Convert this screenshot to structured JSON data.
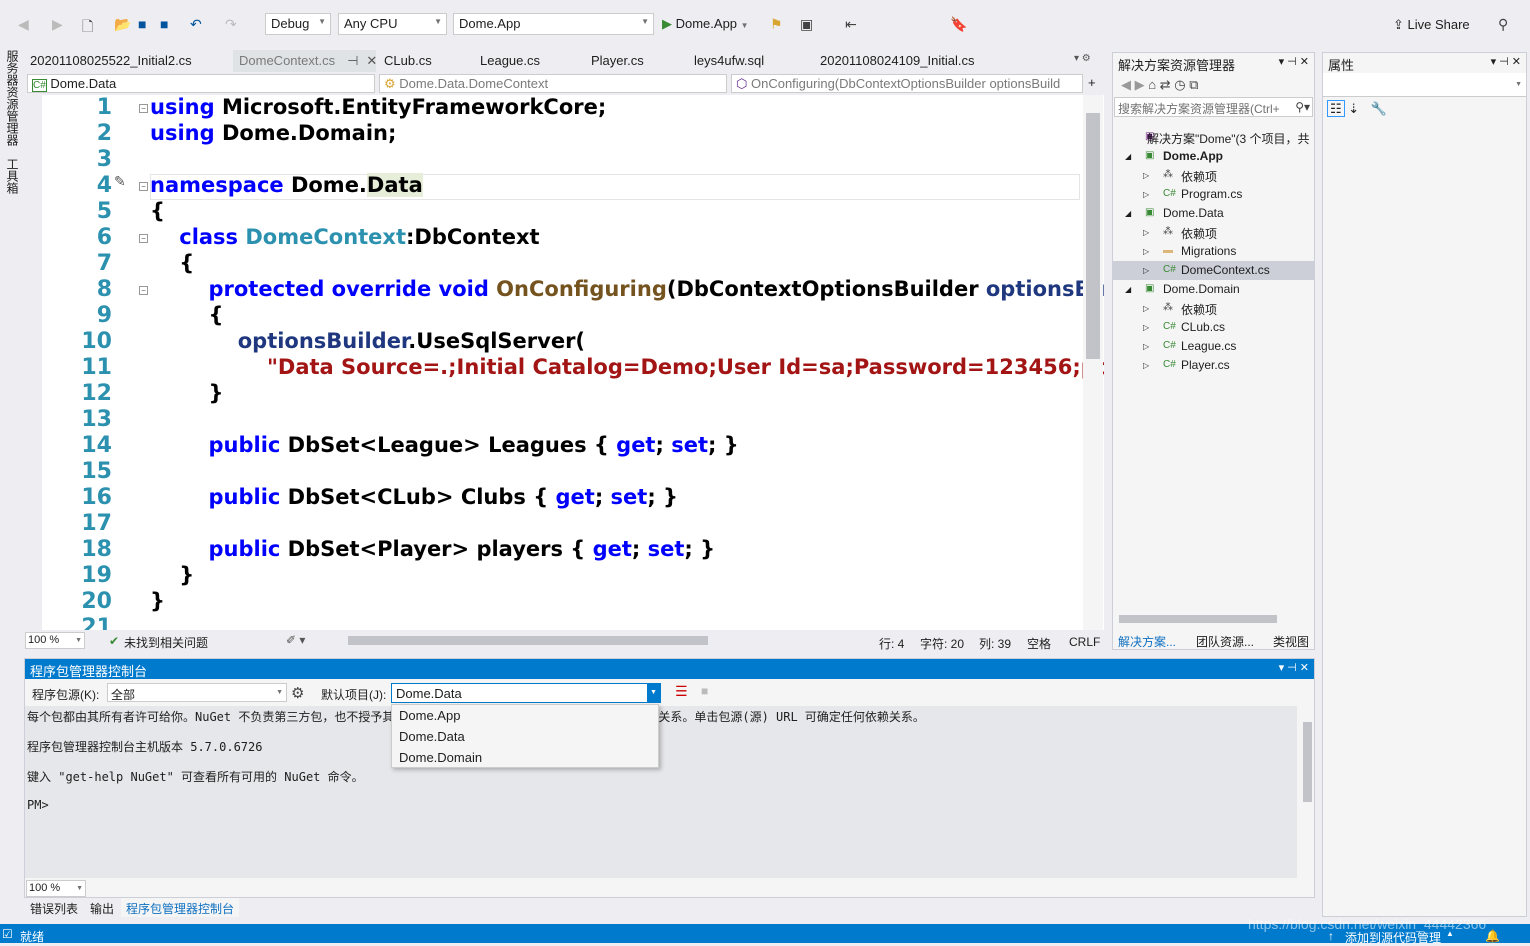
{
  "toolbar": {
    "config": "Debug",
    "platform": "Any CPU",
    "startup_project": "Dome.App",
    "run_label": "Dome.App",
    "live_share": "Live Share"
  },
  "left_strip": {
    "server_explorer": "服务器资源管理器",
    "toolbox": "工具箱"
  },
  "tabs": [
    {
      "label": "20201108025522_Initial2.cs"
    },
    {
      "label": "DomeContext.cs",
      "active": true
    },
    {
      "label": "CLub.cs"
    },
    {
      "label": "League.cs"
    },
    {
      "label": "Player.cs"
    },
    {
      "label": "leys4ufw.sql"
    },
    {
      "label": "20201108024109_Initial.cs"
    }
  ],
  "navbar": {
    "project": "Dome.Data",
    "type": "Dome.Data.DomeContext",
    "member": "OnConfiguring(DbContextOptionsBuilder optionsBuild"
  },
  "editor": {
    "line_numbers": [
      "1",
      "2",
      "3",
      "4",
      "5",
      "6",
      "7",
      "8",
      "9",
      "10",
      "11",
      "12",
      "13",
      "14",
      "15",
      "16",
      "17",
      "18",
      "19",
      "20",
      "21"
    ],
    "lines": [
      [
        [
          "using ",
          "kw"
        ],
        [
          "Microsoft.EntityFrameworkCore;",
          ""
        ]
      ],
      [
        [
          "using ",
          "kw"
        ],
        [
          "Dome.Domain;",
          ""
        ]
      ],
      [],
      [
        [
          "namespace ",
          "kw"
        ],
        [
          "Dome.",
          ""
        ],
        [
          "Data",
          "hl"
        ]
      ],
      [
        [
          "{",
          ""
        ]
      ],
      [
        [
          "    class ",
          "kw"
        ],
        [
          "DomeContext",
          "ty"
        ],
        [
          ":DbContext",
          ""
        ]
      ],
      [
        [
          "    {",
          ""
        ]
      ],
      [
        [
          "        protected override void ",
          "kw"
        ],
        [
          "OnConfiguring",
          "mt"
        ],
        [
          "(DbContextOptionsBuilder ",
          ""
        ],
        [
          "optionsBuilder)",
          "pa"
        ]
      ],
      [
        [
          "        {",
          ""
        ]
      ],
      [
        [
          "            optionsBuilder",
          "pa"
        ],
        [
          ".UseSqlServer(",
          ""
        ]
      ],
      [
        [
          "                \"Data Source=.;Initial Catalog=Demo;User Id=sa;Password=123456;pooling=true\");",
          "st"
        ]
      ],
      [
        [
          "        }",
          ""
        ]
      ],
      [],
      [
        [
          "        public ",
          "kw"
        ],
        [
          "DbSet<League> Leagues { ",
          ""
        ],
        [
          "get",
          "kw"
        ],
        [
          "; ",
          ""
        ],
        [
          "set",
          "kw"
        ],
        [
          "; }",
          ""
        ]
      ],
      [],
      [
        [
          "        public ",
          "kw"
        ],
        [
          "DbSet<CLub> Clubs { ",
          ""
        ],
        [
          "get",
          "kw"
        ],
        [
          "; ",
          ""
        ],
        [
          "set",
          "kw"
        ],
        [
          "; }",
          ""
        ]
      ],
      [],
      [
        [
          "        public ",
          "kw"
        ],
        [
          "DbSet<Player> players { ",
          ""
        ],
        [
          "get",
          "kw"
        ],
        [
          "; ",
          ""
        ],
        [
          "set",
          "kw"
        ],
        [
          "; }",
          ""
        ]
      ],
      [
        [
          "    }",
          ""
        ]
      ],
      [
        [
          "}",
          ""
        ]
      ],
      []
    ]
  },
  "editor_status": {
    "zoom": "100 %",
    "issues": "未找到相关问题",
    "line": "行: 4",
    "char": "字符: 20",
    "col": "列: 39",
    "whitespace": "空格",
    "eol": "CRLF"
  },
  "solution_explorer": {
    "title": "解决方案资源管理器",
    "search_placeholder": "搜索解决方案资源管理器(Ctrl+",
    "items": [
      {
        "label": "解决方案\"Dome\"(3 个项目，共",
        "level": 0,
        "icon": "solution-icon"
      },
      {
        "label": "Dome.App",
        "level": 0,
        "icon": "csproj-icon",
        "bold": true,
        "expanded": true
      },
      {
        "label": "依赖项",
        "level": 1,
        "icon": "dependencies-icon"
      },
      {
        "label": "Program.cs",
        "level": 1,
        "icon": "csharp-file-icon"
      },
      {
        "label": "Dome.Data",
        "level": 0,
        "icon": "csproj-icon",
        "expanded": true
      },
      {
        "label": "依赖项",
        "level": 1,
        "icon": "dependencies-icon"
      },
      {
        "label": "Migrations",
        "level": 1,
        "icon": "folder-icon"
      },
      {
        "label": "DomeContext.cs",
        "level": 1,
        "icon": "csharp-file-icon",
        "selected": true
      },
      {
        "label": "Dome.Domain",
        "level": 0,
        "icon": "csproj-icon",
        "expanded": true
      },
      {
        "label": "依赖项",
        "level": 1,
        "icon": "dependencies-icon"
      },
      {
        "label": "CLub.cs",
        "level": 1,
        "icon": "csharp-file-icon"
      },
      {
        "label": "League.cs",
        "level": 1,
        "icon": "csharp-file-icon"
      },
      {
        "label": "Player.cs",
        "level": 1,
        "icon": "csharp-file-icon"
      }
    ],
    "bottom_tabs": [
      "解决方案...",
      "团队资源...",
      "类视图"
    ]
  },
  "properties": {
    "title": "属性"
  },
  "pmc": {
    "title": "程序包管理器控制台",
    "source_label": "程序包源(K):",
    "source_value": "全部",
    "project_label": "默认项目(J):",
    "project_value": "Dome.Data",
    "output": [
      "每个包都由其所有者许可给你。NuGet 不负责第三方包，也不授予其许可证。一些包可能包括受其他许可证约束的依赖关系。单击包源(源) URL 可确定任何依赖关系。",
      "程序包管理器控制台主机版本 5.7.0.6726",
      "键入 \"get-help NuGet\" 可查看所有可用的 NuGet 命令。",
      "PM>"
    ],
    "dropdown_options": [
      "Dome.App",
      "Dome.Data",
      "Dome.Domain"
    ],
    "zoom": "100 %"
  },
  "bottom_tabs": [
    "错误列表",
    "输出",
    "程序包管理器控制台"
  ],
  "status": {
    "ready": "就绪",
    "source_control": "添加到源代码管理",
    "watermark": "https://blog.csdn.net/weixin_44442366"
  },
  "colors": {
    "accent": "#007acc",
    "keyword": "#0000ff",
    "type": "#2b91af",
    "string": "#a31515"
  }
}
